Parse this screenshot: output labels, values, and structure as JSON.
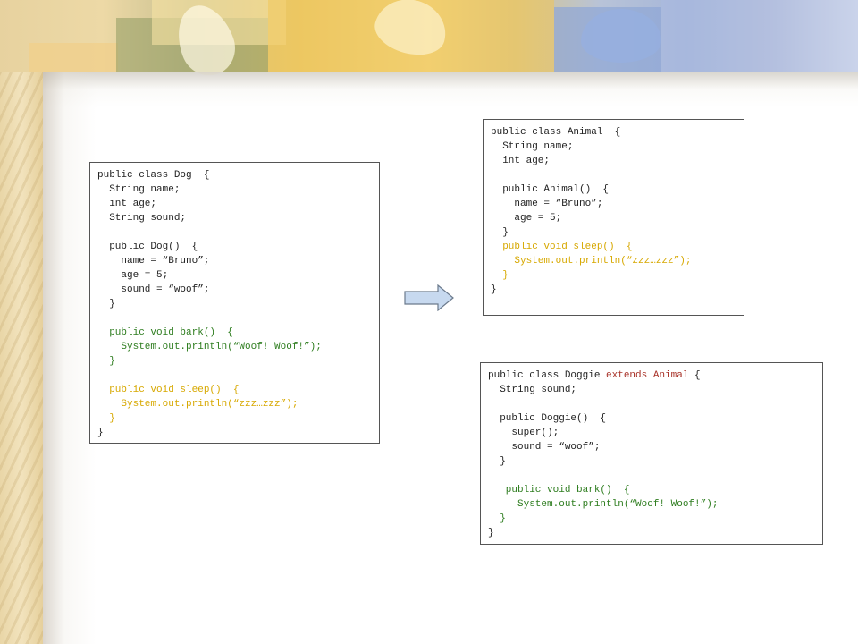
{
  "slide": {
    "dog_class": {
      "lines": [
        {
          "text": "public class Dog  {",
          "color": "default"
        },
        {
          "text": "  String name;",
          "color": "default"
        },
        {
          "text": "  int age;",
          "color": "default"
        },
        {
          "text": "  String sound;",
          "color": "default"
        },
        {
          "text": "",
          "color": "default"
        },
        {
          "text": "  public Dog()  {",
          "color": "default"
        },
        {
          "text": "    name = “Bruno”;",
          "color": "default"
        },
        {
          "text": "    age = 5;",
          "color": "default"
        },
        {
          "text": "    sound = “woof”;",
          "color": "default"
        },
        {
          "text": "  }",
          "color": "default"
        },
        {
          "text": "",
          "color": "default"
        },
        {
          "text": "  public void bark()  {",
          "color": "green"
        },
        {
          "text": "    System.out.println(“Woof! Woof!”);",
          "color": "green"
        },
        {
          "text": "  }",
          "color": "green"
        },
        {
          "text": "",
          "color": "default"
        },
        {
          "text": "  public void sleep()  {",
          "color": "yellow"
        },
        {
          "text": "    System.out.println(“zzz…zzz”);",
          "color": "yellow"
        },
        {
          "text": "  }",
          "color": "yellow"
        },
        {
          "text": "}",
          "color": "default"
        }
      ]
    },
    "animal_class": {
      "lines": [
        {
          "text": "public class Animal  {",
          "color": "default"
        },
        {
          "text": "  String name;",
          "color": "default"
        },
        {
          "text": "  int age;",
          "color": "default"
        },
        {
          "text": "",
          "color": "default"
        },
        {
          "text": "  public Animal()  {",
          "color": "default"
        },
        {
          "text": "    name = “Bruno”;",
          "color": "default"
        },
        {
          "text": "    age = 5;",
          "color": "default"
        },
        {
          "text": "  }",
          "color": "default"
        },
        {
          "text": "  public void sleep()  {",
          "color": "yellow"
        },
        {
          "text": "    System.out.println(“zzz…zzz”);",
          "color": "yellow"
        },
        {
          "text": "  }",
          "color": "yellow"
        },
        {
          "text": "}",
          "color": "default"
        }
      ]
    },
    "doggie_class": {
      "lines": [
        {
          "segments": [
            {
              "text": "public class Doggie ",
              "color": "default"
            },
            {
              "text": "extends Animal",
              "color": "red"
            },
            {
              "text": " {",
              "color": "default"
            }
          ]
        },
        {
          "text": "  String sound;",
          "color": "default"
        },
        {
          "text": "",
          "color": "default"
        },
        {
          "text": "  public Doggie()  {",
          "color": "default"
        },
        {
          "text": "    super();",
          "color": "default"
        },
        {
          "text": "    sound = “woof”;",
          "color": "default"
        },
        {
          "text": "  }",
          "color": "default"
        },
        {
          "text": "",
          "color": "default"
        },
        {
          "text": "   public void bark()  {",
          "color": "green"
        },
        {
          "text": "     System.out.println(“Woof! Woof!”);",
          "color": "green"
        },
        {
          "text": "  }",
          "color": "green"
        },
        {
          "text": "}",
          "color": "default"
        }
      ]
    },
    "arrow_icon": "right-arrow-icon",
    "colors": {
      "default": "#222222",
      "green": "#2e7d1f",
      "yellow": "#d7a800",
      "red": "#a83228",
      "arrow_fill": "#c7d9ef",
      "arrow_stroke": "#6b7a8c"
    }
  }
}
